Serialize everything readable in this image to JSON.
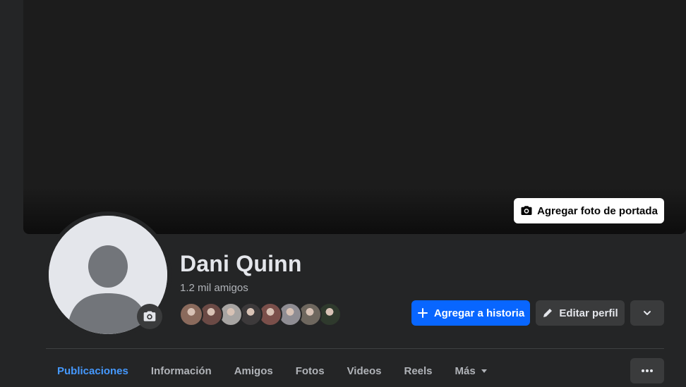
{
  "cover": {
    "add_cover_label": "Agregar foto de portada",
    "icon": "camera-icon"
  },
  "profile": {
    "name": "Dani Quinn",
    "friends_count": "1.2 mil amigos",
    "avatar_icon": "default-avatar-silhouette",
    "avatar_camera_icon": "camera-icon"
  },
  "friend_avatars": [
    {
      "name": "friend-avatar-1",
      "color": "#8a6a5c"
    },
    {
      "name": "friend-avatar-2",
      "color": "#6b4a45"
    },
    {
      "name": "friend-avatar-3",
      "color": "#a7a4a2"
    },
    {
      "name": "friend-avatar-4",
      "color": "#3d3a3b"
    },
    {
      "name": "friend-avatar-5",
      "color": "#7a4f4a"
    },
    {
      "name": "friend-avatar-6",
      "color": "#8f8d93"
    },
    {
      "name": "friend-avatar-7",
      "color": "#6e675e"
    },
    {
      "name": "friend-avatar-8",
      "color": "#2f3a2d"
    }
  ],
  "actions": {
    "add_story_label": "Agregar a historia",
    "add_story_icon": "plus-icon",
    "edit_profile_label": "Editar perfil",
    "edit_profile_icon": "pencil-icon",
    "expand_icon": "chevron-down-icon"
  },
  "tabs": [
    {
      "label": "Publicaciones",
      "active": true
    },
    {
      "label": "Información",
      "active": false
    },
    {
      "label": "Amigos",
      "active": false
    },
    {
      "label": "Fotos",
      "active": false
    },
    {
      "label": "Videos",
      "active": false
    },
    {
      "label": "Reels",
      "active": false
    },
    {
      "label": "Más",
      "active": false
    }
  ],
  "more_menu_icon": "ellipsis-icon",
  "colors": {
    "background": "#242526",
    "primary": "#0866ff",
    "active_tab": "#4599ff",
    "secondary_button": "#3a3b3c"
  }
}
